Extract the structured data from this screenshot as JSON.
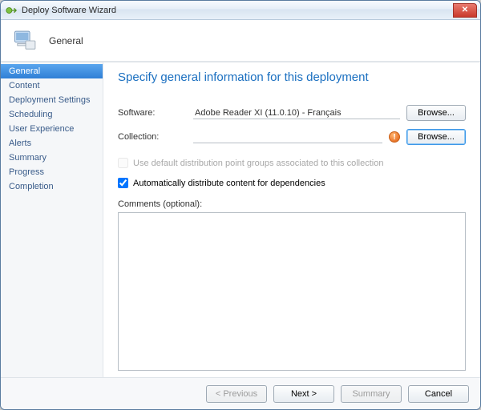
{
  "window": {
    "title": "Deploy Software Wizard"
  },
  "header": {
    "label": "General"
  },
  "sidebar": {
    "items": [
      {
        "label": "General",
        "active": true
      },
      {
        "label": "Content"
      },
      {
        "label": "Deployment Settings"
      },
      {
        "label": "Scheduling"
      },
      {
        "label": "User Experience"
      },
      {
        "label": "Alerts"
      },
      {
        "label": "Summary"
      },
      {
        "label": "Progress"
      },
      {
        "label": "Completion"
      }
    ]
  },
  "page": {
    "title": "Specify general information for this deployment",
    "software_label": "Software:",
    "software_value": "Adobe Reader XI (11.0.10) - Français",
    "collection_label": "Collection:",
    "collection_value": "",
    "browse_label": "Browse...",
    "use_default_label": "Use default distribution point groups associated to this collection",
    "auto_distribute_label": "Automatically distribute content for dependencies",
    "comments_label": "Comments (optional):",
    "comments_value": ""
  },
  "footer": {
    "previous": "< Previous",
    "next": "Next >",
    "summary": "Summary",
    "cancel": "Cancel"
  },
  "state": {
    "use_default_checked": false,
    "use_default_enabled": false,
    "auto_distribute_checked": true,
    "previous_enabled": false,
    "next_enabled": true,
    "summary_enabled": false
  }
}
